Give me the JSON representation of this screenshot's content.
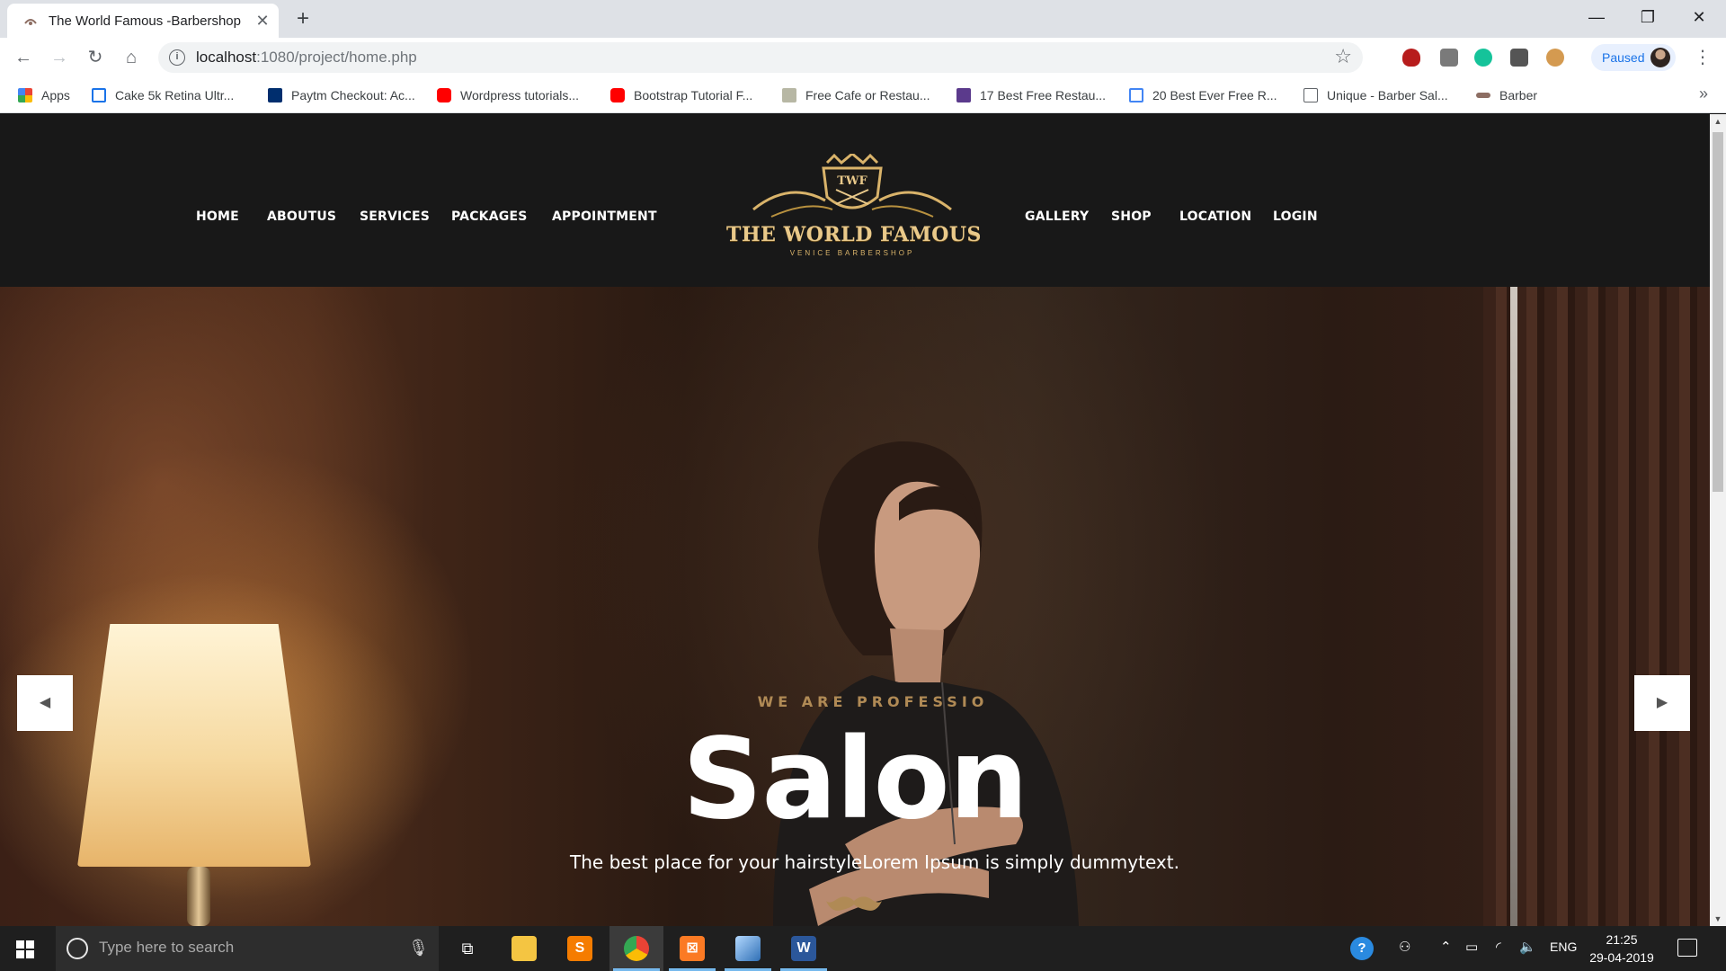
{
  "browser": {
    "tab_title": "The World Famous -Barbershop",
    "tab_close": "✕",
    "new_tab": "+",
    "window": {
      "minimize": "—",
      "restore": "❐",
      "close": "✕"
    },
    "url_host": "localhost",
    "url_path": ":1080/project/home.php",
    "paused_label": "Paused",
    "bookmarks": [
      {
        "label": "Apps",
        "icon": "apps-grid-icon",
        "color": "#ea4335"
      },
      {
        "label": "Cake 5k Retina Ultr...",
        "icon": "w-logo-icon",
        "color": "#1a73e8"
      },
      {
        "label": "Paytm Checkout: Ac...",
        "icon": "paytm-icon",
        "color": "#002e6e"
      },
      {
        "label": "Wordpress tutorials...",
        "icon": "youtube-icon",
        "color": "#ff0000"
      },
      {
        "label": "Bootstrap Tutorial F...",
        "icon": "youtube-icon",
        "color": "#ff0000"
      },
      {
        "label": "Free Cafe or Restau...",
        "icon": "css-site-icon",
        "color": "#b7b7a4"
      },
      {
        "label": "17 Best Free Restau...",
        "icon": "colorlib-icon",
        "color": "#5b3a8c"
      },
      {
        "label": "20 Best Ever Free R...",
        "icon": "page-blue-icon",
        "color": "#4285f4"
      },
      {
        "label": "Unique - Barber Sal...",
        "icon": "document-icon",
        "color": "#5f6368"
      },
      {
        "label": "Barber",
        "icon": "mustache-icon",
        "color": "#8d6e63"
      }
    ],
    "bookmarks_more": "»"
  },
  "site": {
    "nav_left": [
      "HOME",
      "ABOUTUS",
      "SERVICES",
      "PACKAGES",
      "APPOINTMENT"
    ],
    "nav_right": [
      "GALLERY",
      "SHOP",
      "LOCATION",
      "LOGIN"
    ],
    "logo_monogram": "TWF",
    "logo_title": "THE WORLD FAMOUS",
    "logo_subtitle": "VENICE BARBERSHOP",
    "hero": {
      "kicker": "WE ARE PROFESSIO",
      "title": "Salon",
      "subtitle": "The best place for your hairstyleLorem Ipsum is simply dummytext.",
      "prev": "◀",
      "next": "▶"
    },
    "accent_color": "#d9b36a"
  },
  "taskbar": {
    "search_placeholder": "Type here to search",
    "language": "ENG",
    "time": "21:25",
    "date": "29-04-2019",
    "apps": [
      "task-view",
      "file-explorer",
      "sublime-text",
      "chrome",
      "xampp",
      "virtualbox",
      "word"
    ]
  }
}
